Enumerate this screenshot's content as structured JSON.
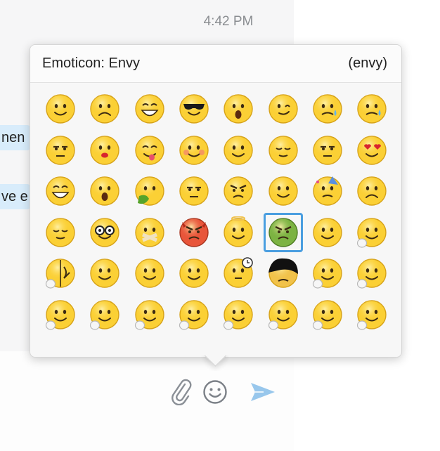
{
  "chat": {
    "timestamp": "4:42 PM",
    "bubble_1": "nen",
    "bubble_2": "ve e"
  },
  "composer": {
    "attach_icon": "paperclip-icon",
    "emoticon_icon": "smiley-icon",
    "send_icon": "send-arrow-icon"
  },
  "popup": {
    "name": "Emoticon: Envy",
    "code": "(envy)"
  },
  "colors": {
    "accent": "#4a9ee0",
    "face_yellow": "#fbd035",
    "envy_green": "#7cb342",
    "devil_red": "#e8553a",
    "bubble": "#d8ecfb"
  },
  "emoticons": [
    "smile",
    "sad",
    "laugh",
    "cool",
    "surprised",
    "wink",
    "crying",
    "sweating",
    "speechless",
    "kiss",
    "tongue-out",
    "blush",
    "wondering",
    "sleepy",
    "dull",
    "in-love",
    "evil-grin",
    "yawn",
    "puke",
    "doh",
    "angry",
    "itwasntme",
    "party",
    "worried",
    "smirk",
    "nerd",
    "lips-sealed",
    "devil",
    "angel",
    "envy",
    "make-up",
    "think",
    "rofl",
    "happy",
    "nod",
    "shake",
    "waiting",
    "emo",
    "hi",
    "facepalm",
    "fingers-crossed",
    "lalala",
    "chuckle",
    "hand-wave",
    "muscle",
    "bow",
    "talk-to-the-hand",
    "pointing"
  ],
  "selected_emoticon": "envy"
}
